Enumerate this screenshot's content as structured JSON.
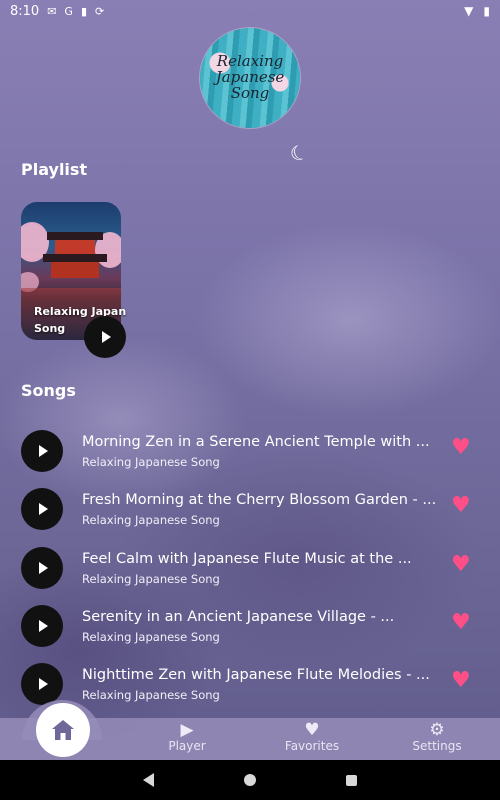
{
  "status_bar": {
    "time": "8:10",
    "left_icons": [
      "gmail-icon",
      "google-icon",
      "sd-card-icon",
      "sync-icon"
    ],
    "right_icons": [
      "wifi-icon",
      "battery-icon"
    ]
  },
  "logo": {
    "lines": [
      "Relaxing",
      "Japanese",
      "Song"
    ]
  },
  "sections": {
    "playlist_title": "Playlist",
    "songs_title": "Songs"
  },
  "playlist": {
    "title": "Relaxing Japan Song"
  },
  "songs": [
    {
      "title": "Morning Zen in a Serene Ancient Temple with ...",
      "artist": "Relaxing Japanese Song"
    },
    {
      "title": "Fresh Morning at the Cherry Blossom Garden - ...",
      "artist": "Relaxing Japanese Song"
    },
    {
      "title": "Feel Calm with Japanese Flute Music at the ...",
      "artist": "Relaxing Japanese Song"
    },
    {
      "title": "Serenity in an Ancient Japanese Village - ...",
      "artist": "Relaxing Japanese Song"
    },
    {
      "title": "Nighttime Zen with Japanese Flute Melodies - ...",
      "artist": "Relaxing Japanese Song"
    }
  ],
  "nav": {
    "player": "Player",
    "favorites": "Favorites",
    "settings": "Settings"
  },
  "colors": {
    "heart": "#ff4f86",
    "play_button": "#111111"
  }
}
